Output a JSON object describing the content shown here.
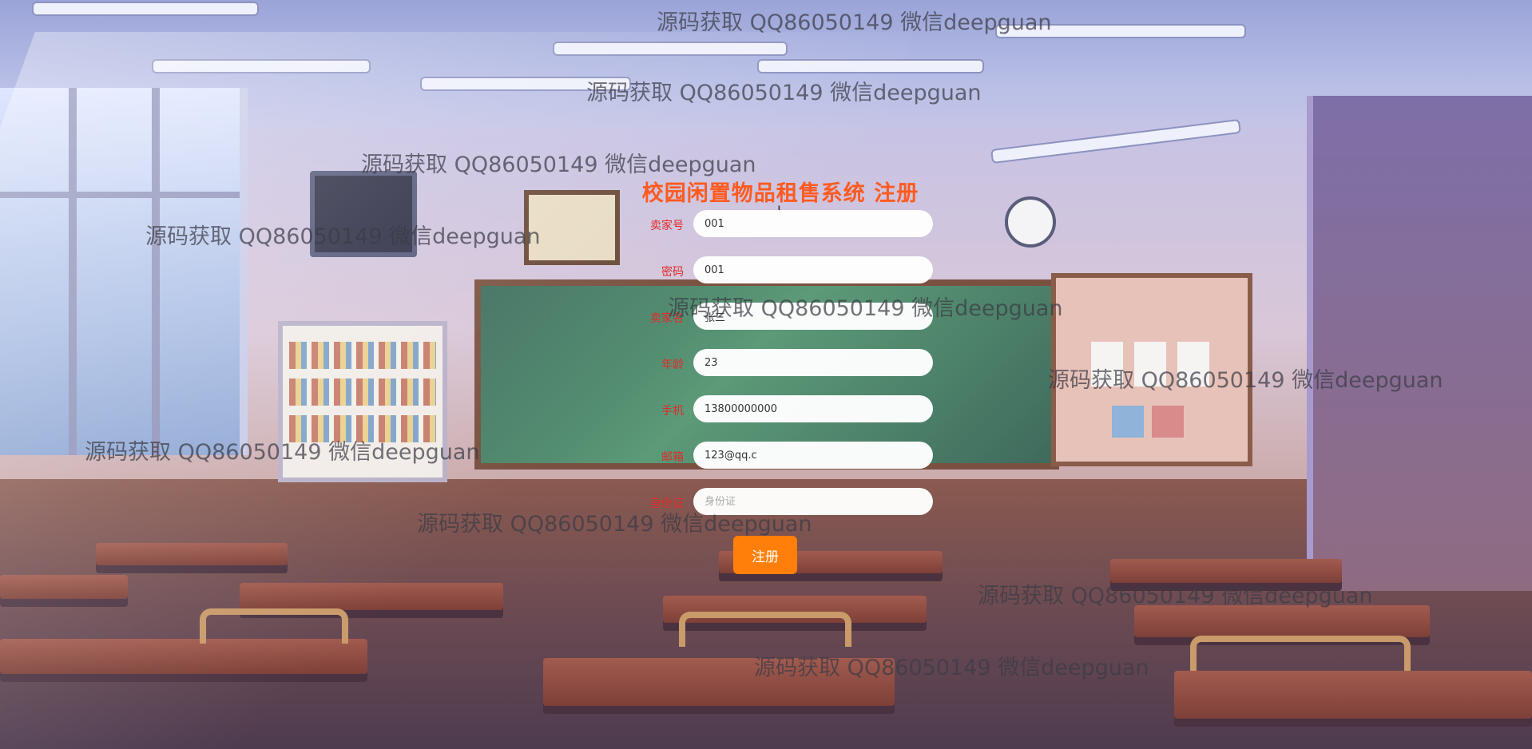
{
  "form": {
    "title": "校园闲置物品租售系统 注册",
    "fields": [
      {
        "label": "卖家号",
        "value": "001",
        "placeholder": ""
      },
      {
        "label": "密码",
        "value": "001",
        "placeholder": ""
      },
      {
        "label": "卖家名",
        "value": "张三",
        "placeholder": ""
      },
      {
        "label": "年龄",
        "value": "23",
        "placeholder": ""
      },
      {
        "label": "手机",
        "value": "13800000000",
        "placeholder": ""
      },
      {
        "label": "邮箱",
        "value": "123@qq.c",
        "placeholder": ""
      },
      {
        "label": "身份证",
        "value": "",
        "placeholder": "身份证"
      }
    ],
    "submit_label": "注册"
  },
  "watermark_text": "源码获取 QQ86050149 微信deepguan",
  "colors": {
    "title": "#ff5a1f",
    "label": "#e02a2a",
    "button": "#ff7f0a"
  }
}
